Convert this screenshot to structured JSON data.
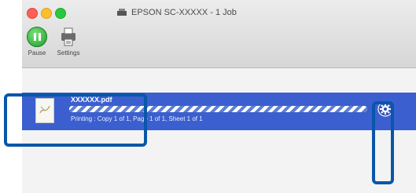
{
  "window": {
    "title": "EPSON SC-XXXXX - 1 Job"
  },
  "toolbar": {
    "pause_label": "Pause",
    "settings_label": "Settings"
  },
  "job": {
    "name": "XXXXXX.pdf",
    "status": "Printing : Copy 1 of 1, Page 1 of 1, Sheet 1 of 1",
    "progress": 1.0
  },
  "colors": {
    "selection": "#3b5fcf",
    "callout": "#0a56a8",
    "pause_button": "#1c9e2a"
  },
  "icons": [
    "printer-icon",
    "pause-icon",
    "settings-icon",
    "document-icon",
    "job-settings-gear-icon"
  ]
}
